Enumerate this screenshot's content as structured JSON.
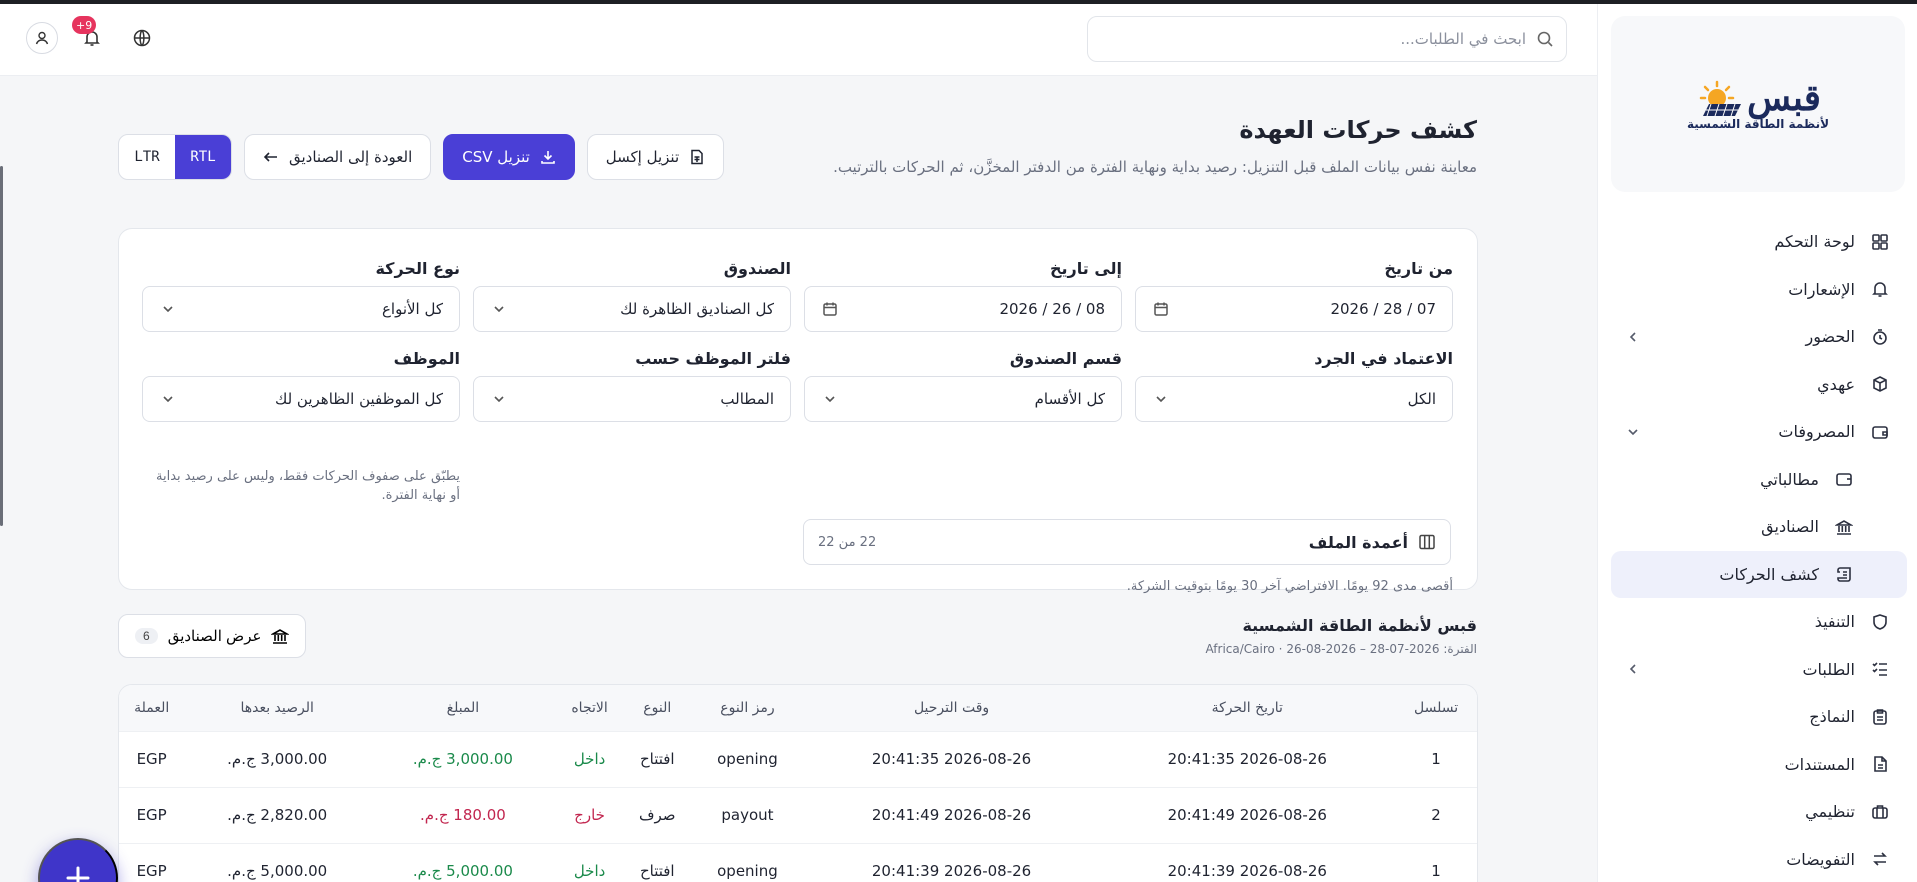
{
  "brand": {
    "name": "قبس",
    "tagline": "لأنظمة الطاقة الشمسية",
    "colors": {
      "primary": "#4a3fd6",
      "sun": "#f5a623",
      "navy": "#1b2a5c"
    }
  },
  "header": {
    "search_placeholder": "ابحث في الطلبات...",
    "notifications_badge": "+9"
  },
  "sidebar": {
    "items": [
      {
        "label": "لوحة التحكم",
        "icon": "grid-icon"
      },
      {
        "label": "الإشعارات",
        "icon": "bell-icon"
      },
      {
        "label": "الحضور",
        "icon": "clock-icon"
      },
      {
        "label": "عهدي",
        "icon": "cube-icon"
      },
      {
        "label": "المصروفات",
        "icon": "wallet-icon"
      },
      {
        "label": "مطالباتي",
        "icon": "receipt-icon"
      },
      {
        "label": "الصناديق",
        "icon": "bank-icon"
      },
      {
        "label": "كشف الحركات",
        "icon": "scroll-icon"
      },
      {
        "label": "التنفيذ",
        "icon": "shield-icon"
      },
      {
        "label": "الطلبات",
        "icon": "checklist-icon"
      },
      {
        "label": "النماذج",
        "icon": "clipboard-icon"
      },
      {
        "label": "المستندات",
        "icon": "document-icon"
      },
      {
        "label": "تنظيمي",
        "icon": "briefcase-icon"
      },
      {
        "label": "التفويضات",
        "icon": "arrows-icon"
      }
    ]
  },
  "page": {
    "title": "كشف حركات العهدة",
    "description": "معاينة نفس بيانات الملف قبل التنزيل: رصيد بداية ونهاية الفترة من الدفتر المخزَّن، ثم الحركات بالترتيب."
  },
  "actions": {
    "excel": "تنزيل إكسل",
    "csv": "تنزيل CSV",
    "back": "العودة إلى الصناديق",
    "rtl": "RTL",
    "ltr": "LTR"
  },
  "filters": {
    "from_date": {
      "label": "من تاريخ",
      "value": "07 / 28 / 2026"
    },
    "to_date": {
      "label": "إلى تاريخ",
      "value": "08 / 26 / 2026"
    },
    "box": {
      "label": "الصندوق",
      "value": "كل الصناديق الظاهرة لك"
    },
    "movement_type": {
      "label": "نوع الحركة",
      "value": "كل الأنواع"
    },
    "inventory": {
      "label": "الاعتماد في الجرد",
      "value": "الكل"
    },
    "box_section": {
      "label": "قسم الصندوق",
      "value": "كل الأقسام"
    },
    "employee_filter": {
      "label": "فلتر الموظف حسب",
      "value": "المطالب"
    },
    "employee": {
      "label": "الموظف",
      "value": "كل الموظفين الظاهرين لك"
    },
    "employee_hint": "يطبّق على صفوف الحركات فقط، وليس على رصيد بداية أو نهاية الفترة.",
    "columns_label": "أعمدة الملف",
    "columns_count": "22 من 22",
    "range_hint": "أقصى مدى 92 يومًا. الافتراضي آخر 30 يومًا بتوقيت الشركة."
  },
  "summary": {
    "company": "قبس لأنظمة الطاقة الشمسية",
    "period": "الفترة: 2026-07-28 – 2026-08-26 · Africa/Cairo",
    "show_boxes": "عرض الصناديق",
    "boxes_count": "6"
  },
  "table": {
    "headers": [
      "تسلسل",
      "تاريخ الحركة",
      "وقت الترحيل",
      "رمز النوع",
      "النوع",
      "الاتجاه",
      "المبلغ",
      "الرصيد بعدها",
      "العملة"
    ],
    "rows": [
      {
        "seq": "1",
        "date": "2026-08-26 20:41:35",
        "posted": "2026-08-26 20:41:35",
        "code": "opening",
        "type": "افتتاح",
        "dir": "داخل",
        "dir_kind": "in",
        "amount": "3,000.00 ج.م.",
        "balance": "3,000.00 ج.م.",
        "currency": "EGP"
      },
      {
        "seq": "2",
        "date": "2026-08-26 20:41:49",
        "posted": "2026-08-26 20:41:49",
        "code": "payout",
        "type": "صرف",
        "dir": "خارج",
        "dir_kind": "out",
        "amount": "180.00 ج.م.",
        "balance": "2,820.00 ج.م.",
        "currency": "EGP"
      },
      {
        "seq": "1",
        "date": "2026-08-26 20:41:39",
        "posted": "2026-08-26 20:41:39",
        "code": "opening",
        "type": "افتتاح",
        "dir": "داخل",
        "dir_kind": "in",
        "amount": "5,000.00 ج.م.",
        "balance": "5,000.00 ج.م.",
        "currency": "EGP"
      }
    ]
  }
}
